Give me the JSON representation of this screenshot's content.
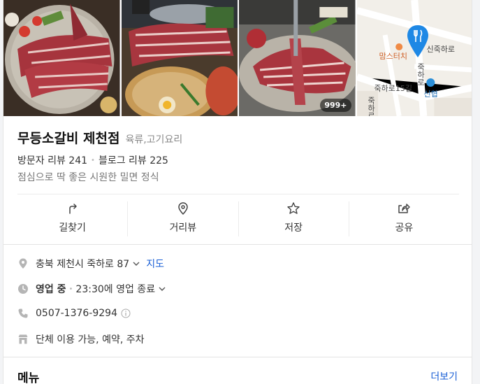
{
  "photos": {
    "count_badge": "999+"
  },
  "map": {
    "street_1": "신죽하로",
    "street_2": "죽하로",
    "street_3": "죽하로15길",
    "street_4": "죽하로11길",
    "poi_1": "맘스터치",
    "poi_2": "신협",
    "pin_color": "#1e88e5"
  },
  "place": {
    "name": "무등소갈비 제천점",
    "category": "육류,고기요리",
    "visitor_reviews": "방문자 리뷰 241",
    "blog_reviews": "블로그 리뷰 225",
    "tagline": "점심으로 딱 좋은 시원한 밀면 정식"
  },
  "actions": [
    {
      "label": "길찾기",
      "icon": "directions-icon"
    },
    {
      "label": "거리뷰",
      "icon": "streetview-icon"
    },
    {
      "label": "저장",
      "icon": "star-icon"
    },
    {
      "label": "공유",
      "icon": "share-icon"
    }
  ],
  "info": {
    "address": "충북 제천시 죽하로 87",
    "map_link": "지도",
    "status": "영업 중",
    "hours": "23:30에 영업 종료",
    "phone": "0507-1376-9294",
    "amenities": "단체 이용 가능, 예약, 주차"
  },
  "menu": {
    "title": "메뉴",
    "more": "더보기"
  },
  "colors": {
    "link": "#1a5fd6",
    "icon_gray": "#b5b5b5"
  }
}
